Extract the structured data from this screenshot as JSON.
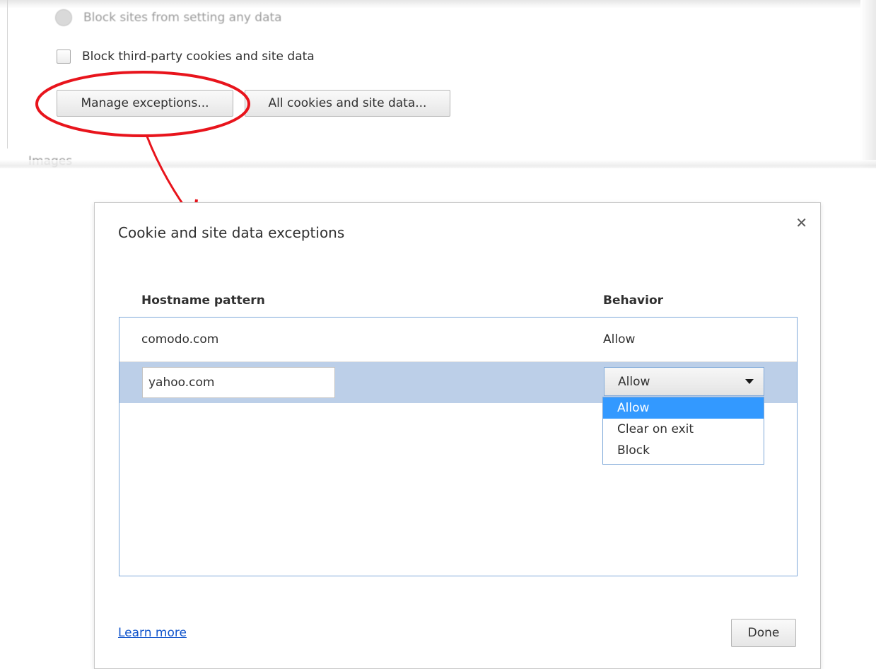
{
  "settings_snippet": {
    "cut_radio_label": "Block sites from setting any data",
    "third_party_label": "Block third-party cookies and site data",
    "manage_exceptions_label": "Manage exceptions...",
    "all_cookies_label": "All cookies and site data...",
    "cut_section_label": "Images",
    "annotation_color": "#e8141c"
  },
  "dialog": {
    "title": "Cookie and site data exceptions",
    "close_icon": "close-icon",
    "columns": {
      "host": "Hostname pattern",
      "behavior": "Behavior"
    },
    "rows": [
      {
        "host": "comodo.com",
        "behavior": "Allow"
      }
    ],
    "new_row": {
      "host_value": "yahoo.com",
      "behavior_selected": "Allow"
    },
    "behavior_options": [
      "Allow",
      "Clear on exit",
      "Block"
    ],
    "selected_row_color": "#bccfe8",
    "highlight_color": "#3399ff",
    "learn_more_label": "Learn more",
    "done_label": "Done"
  }
}
